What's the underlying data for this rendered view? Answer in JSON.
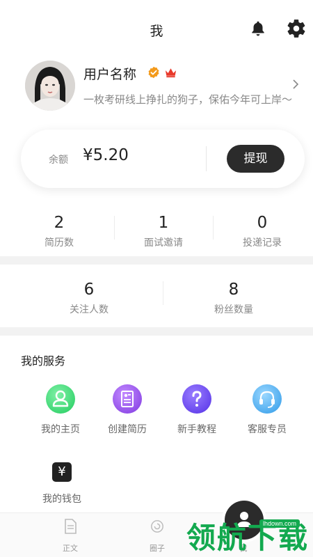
{
  "header": {
    "title": "我"
  },
  "profile": {
    "name": "用户名称",
    "bio": "一枚考研线上挣扎的狗子，保佑今年可上岸～"
  },
  "balance": {
    "label": "余额",
    "value": "¥5.20",
    "withdraw_label": "提现"
  },
  "stats_row1": [
    {
      "value": "2",
      "label": "简历数"
    },
    {
      "value": "1",
      "label": "面试邀请"
    },
    {
      "value": "0",
      "label": "投递记录"
    }
  ],
  "stats_row2": [
    {
      "value": "6",
      "label": "关注人数"
    },
    {
      "value": "8",
      "label": "粉丝数量"
    }
  ],
  "services": {
    "title": "我的服务",
    "items": [
      {
        "label": "我的主页",
        "icon": "user-icon",
        "color": "#2ed573"
      },
      {
        "label": "创建简历",
        "icon": "resume-icon",
        "color": "#8e44ef"
      },
      {
        "label": "新手教程",
        "icon": "question-icon",
        "color": "#6c4cf0"
      },
      {
        "label": "客服专员",
        "icon": "headset-icon",
        "color": "#3fa9f5"
      },
      {
        "label": "我的钱包",
        "icon": "yuan-icon",
        "color": "#222222"
      }
    ]
  },
  "tabbar": {
    "items": [
      {
        "label": "正文"
      },
      {
        "label": "圈子"
      },
      {
        "label": "我"
      }
    ]
  },
  "watermark": {
    "text": "领航下载",
    "url": "lhdown.com"
  }
}
